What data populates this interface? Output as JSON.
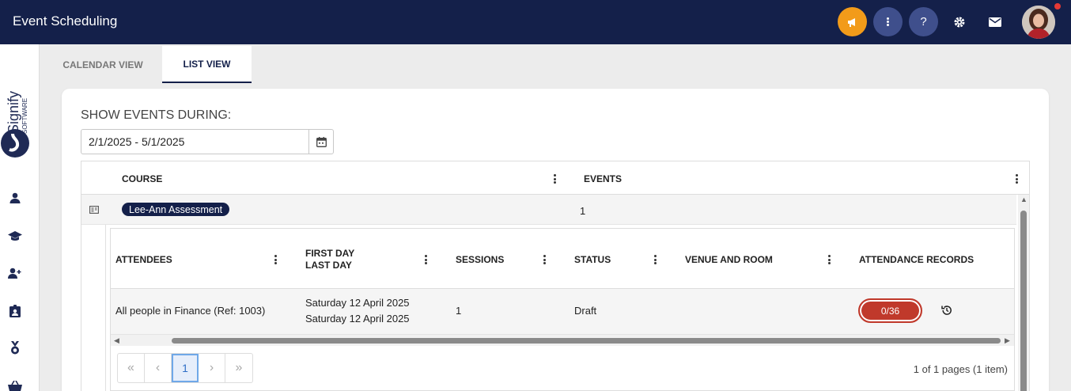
{
  "app": {
    "title": "Event Scheduling"
  },
  "topbar": {
    "icons": [
      "megaphone-icon",
      "more-vertical-icon",
      "help-icon",
      "gear-icon",
      "mail-icon"
    ],
    "help_label": "?",
    "accent_color": "#f29b1a",
    "bar_color": "#14204a"
  },
  "sidebar": {
    "logo_text": "Signify",
    "logo_sub": "SOFTWARE",
    "items": [
      "user-icon",
      "graduation-cap-icon",
      "add-user-icon",
      "id-badge-icon",
      "medal-icon",
      "basket-icon"
    ]
  },
  "tabs": [
    {
      "label": "CALENDAR VIEW",
      "active": false
    },
    {
      "label": "LIST VIEW",
      "active": true
    }
  ],
  "filter": {
    "label": "SHOW EVENTS DURING:",
    "date_range": "2/1/2025 - 5/1/2025"
  },
  "grid": {
    "columns": [
      "COURSE",
      "EVENTS"
    ],
    "rows": [
      {
        "course": "Lee-Ann Assessment",
        "events": "1"
      }
    ]
  },
  "detail": {
    "columns": {
      "attendees": "ATTENDEES",
      "first_day": "FIRST DAY",
      "last_day": "LAST DAY",
      "sessions": "SESSIONS",
      "status": "STATUS",
      "venue": "VENUE AND ROOM",
      "attendance": "ATTENDANCE RECORDS"
    },
    "rows": [
      {
        "attendees": "All people in Finance (Ref: 1003)",
        "first_day": "Saturday 12 April 2025",
        "last_day": "Saturday 12 April 2025",
        "sessions": "1",
        "status": "Draft",
        "venue": "",
        "attendance": "0/36"
      }
    ],
    "attendance_color": "#c0392b"
  },
  "pager": {
    "first": "«",
    "prev": "‹",
    "current": "1",
    "next": "›",
    "last": "»",
    "info": "1 of 1 pages (1 item)"
  }
}
